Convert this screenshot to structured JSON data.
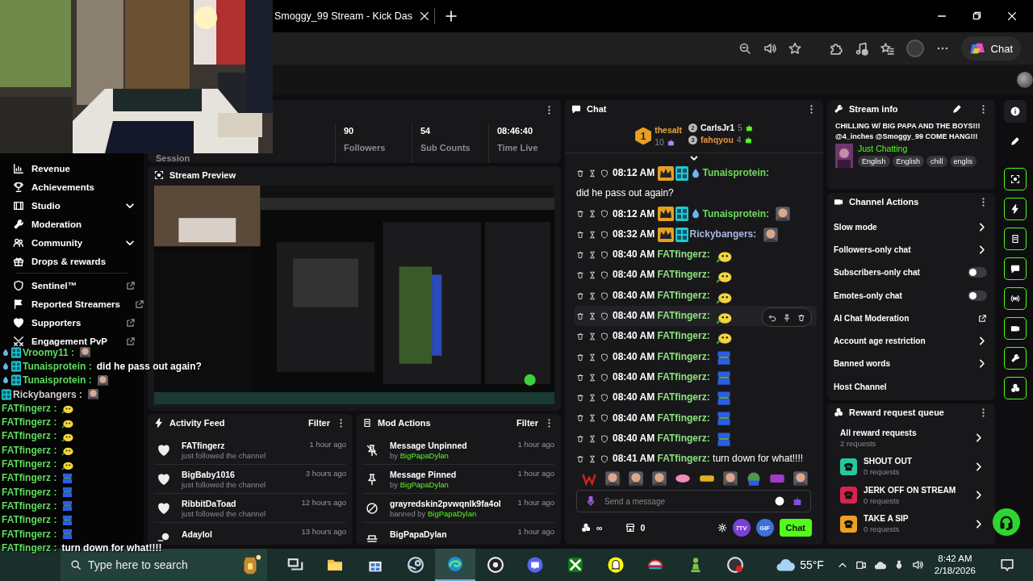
{
  "browser": {
    "tab_title": "Smoggy_99 Stream - Kick Das",
    "copilot_label": "Chat"
  },
  "sidebar": {
    "items": [
      {
        "label": "Revenue",
        "kind": "plain"
      },
      {
        "label": "Achievements",
        "kind": "plain"
      },
      {
        "label": "Studio",
        "kind": "expand"
      },
      {
        "label": "Moderation",
        "kind": "plain"
      },
      {
        "label": "Community",
        "kind": "expand"
      },
      {
        "label": "Drops & rewards",
        "kind": "plain"
      },
      {
        "label": "Sentinel™",
        "kind": "external"
      },
      {
        "label": "Reported Streamers",
        "kind": "external"
      },
      {
        "label": "Supporters",
        "kind": "external"
      },
      {
        "label": "Engagement PvP",
        "kind": "external"
      }
    ]
  },
  "stats": [
    {
      "label": "Session"
    },
    {
      "value": "90",
      "label": "Followers"
    },
    {
      "value": "54",
      "label": "Sub Counts"
    },
    {
      "value": "08:46:40",
      "label": "Time Live"
    }
  ],
  "stream_preview": {
    "title": "Stream Preview"
  },
  "activity_feed": {
    "title": "Activity Feed",
    "filter": "Filter",
    "items": [
      {
        "name": "FATfingerz",
        "detail": "just followed the channel",
        "time": "1 hour ago",
        "kind": "follow"
      },
      {
        "name": "BigBaby1016",
        "detail": "just followed the channel",
        "time": "3 hours ago",
        "kind": "follow"
      },
      {
        "name": "RibbitDaToad",
        "detail": "just followed the channel",
        "time": "12 hours ago",
        "kind": "follow"
      },
      {
        "name": "Adaylol",
        "time": "13 hours ago",
        "kind": "user"
      }
    ]
  },
  "mod_actions": {
    "title": "Mod Actions",
    "filter": "Filter",
    "items": [
      {
        "title": "Message Unpinned",
        "prefix": "by",
        "user": "BigPapaDylan",
        "time": "1 hour ago",
        "kind": "unpin"
      },
      {
        "title": "Message Pinned",
        "prefix": "by",
        "user": "BigPapaDylan",
        "time": "1 hour ago",
        "kind": "pin"
      },
      {
        "title": "grayredskin2pvwqnlk9fa4ol",
        "prefix": "banned by",
        "user": "BigPapaDylan",
        "time": "1 hour ago",
        "kind": "ban"
      },
      {
        "title": "BigPapaDylan",
        "time": "1 hour ago",
        "kind": "hat"
      }
    ]
  },
  "chat": {
    "title": "Chat",
    "leaderboard": [
      {
        "rank": "1",
        "name": "thesalt",
        "count": "10",
        "color": "#e8a53a"
      },
      {
        "rank": "2",
        "name": "CarlsJr1",
        "count": "5",
        "color": "#ffffff"
      },
      {
        "rank": "3",
        "name": "fahqyou",
        "count": "4",
        "color": "#e8933a"
      }
    ],
    "messages": [
      {
        "time": "08:12 AM",
        "badges": [
          {
            "kind": "crown"
          },
          {
            "kind": "grid"
          },
          {
            "kind": "flame"
          }
        ],
        "user": "Tunaisprotein:",
        "color": "#6fdc5a",
        "text": "did he pass out again?",
        "hovered": false
      },
      {
        "time": "08:12 AM",
        "badges": [
          {
            "kind": "crown"
          },
          {
            "kind": "grid"
          },
          {
            "kind": "flame"
          }
        ],
        "user": "Tunaisprotein:",
        "color": "#6fdc5a",
        "emote": {
          "kind": "face"
        },
        "hovered": false
      },
      {
        "time": "08:32 AM",
        "badges": [
          {
            "kind": "crown"
          },
          {
            "kind": "grid"
          }
        ],
        "user": "Rickybangers:",
        "color": "#a9b8e0",
        "emote": {
          "kind": "face"
        },
        "hovered": false
      },
      {
        "time": "08:40 AM",
        "user": "FATfingerz:",
        "color": "#8fe07f",
        "emote": {
          "kind": "smiley"
        },
        "hovered": false
      },
      {
        "time": "08:40 AM",
        "user": "FATfingerz:",
        "color": "#8fe07f",
        "emote": {
          "kind": "smiley"
        },
        "hovered": false
      },
      {
        "time": "08:40 AM",
        "user": "FATfingerz:",
        "color": "#8fe07f",
        "emote": {
          "kind": "smiley"
        },
        "hovered": false
      },
      {
        "time": "08:40 AM",
        "user": "FATfingerz:",
        "color": "#8fe07f",
        "emote": {
          "kind": "smiley"
        },
        "hovered": true
      },
      {
        "time": "08:40 AM",
        "user": "FATfingerz:",
        "color": "#8fe07f",
        "emote": {
          "kind": "smiley"
        },
        "hovered": false
      },
      {
        "time": "08:40 AM",
        "user": "FATfingerz:",
        "color": "#8fe07f",
        "emote": {
          "kind": "blob"
        },
        "hovered": false
      },
      {
        "time": "08:40 AM",
        "user": "FATfingerz:",
        "color": "#8fe07f",
        "emote": {
          "kind": "blob"
        },
        "hovered": false
      },
      {
        "time": "08:40 AM",
        "user": "FATfingerz:",
        "color": "#8fe07f",
        "emote": {
          "kind": "blob"
        },
        "hovered": false
      },
      {
        "time": "08:40 AM",
        "user": "FATfingerz:",
        "color": "#8fe07f",
        "emote": {
          "kind": "blob"
        },
        "hovered": false
      },
      {
        "time": "08:40 AM",
        "user": "FATfingerz:",
        "color": "#8fe07f",
        "emote": {
          "kind": "blob"
        },
        "hovered": false
      },
      {
        "time": "08:41 AM",
        "user": "FATfingerz:",
        "color": "#8fe07f",
        "text": "turn down for what!!!!",
        "hovered": false
      }
    ],
    "emote_bar": [
      {
        "kind": "red"
      },
      {
        "kind": "face"
      },
      {
        "kind": "face"
      },
      {
        "kind": "face"
      },
      {
        "kind": "pink"
      },
      {
        "kind": "gold"
      },
      {
        "kind": "face"
      },
      {
        "kind": "frog"
      },
      {
        "kind": "purple"
      },
      {
        "kind": "face"
      }
    ],
    "input": {
      "placeholder": "Send a message"
    },
    "points": "∞",
    "drops": "0",
    "buttons": [
      {
        "label": "7TV",
        "kind": "seventv"
      },
      {
        "label": "GIF",
        "kind": "gif"
      },
      {
        "label": "Chat",
        "kind": "send"
      }
    ]
  },
  "stream_info": {
    "title": "Stream info",
    "stream_title": "CHILLING W/ BIG PAPA AND THE BOYS!!! @4_inches @Smoggy_99 COME HANG!!!",
    "category": "Just Chatting",
    "tags": [
      "English",
      "English",
      "chill",
      "englis"
    ]
  },
  "channel_actions": {
    "title": "Channel Actions",
    "items": [
      {
        "label": "Slow mode",
        "kind": "link"
      },
      {
        "label": "Followers-only chat",
        "kind": "link"
      },
      {
        "label": "Subscribers-only chat",
        "kind": "toggle",
        "on": false
      },
      {
        "label": "Emotes-only chat",
        "kind": "toggle",
        "on": false
      },
      {
        "label": "AI Chat Moderation",
        "kind": "external"
      },
      {
        "label": "Account age restriction",
        "kind": "link"
      },
      {
        "label": "Banned words",
        "kind": "link"
      },
      {
        "label": "Host Channel",
        "kind": "plain"
      }
    ]
  },
  "reward_queue": {
    "title": "Reward request queue",
    "items": [
      {
        "title": "All reward requests",
        "count": "2 requests",
        "kind": "all"
      },
      {
        "title": "SHOUT OUT",
        "count": "0 requests",
        "kind": "reward",
        "color": "#25c9a0"
      },
      {
        "title": "JERK OFF ON STREAM",
        "count": "0 requests",
        "kind": "reward",
        "color": "#d8224f"
      },
      {
        "title": "TAKE A SIP",
        "count": "0 requests",
        "kind": "reward",
        "color": "#f0a020"
      }
    ]
  },
  "rail": [
    {
      "kind": "plain"
    },
    {
      "kind": "plain"
    },
    {
      "kind": "framed"
    },
    {
      "kind": "framed"
    },
    {
      "kind": "framed"
    },
    {
      "kind": "framed"
    },
    {
      "kind": "framed"
    },
    {
      "kind": "framed"
    },
    {
      "kind": "framed"
    },
    {
      "kind": "framed"
    }
  ],
  "overlay_chat": [
    {
      "badges": [
        {
          "kind": "flame"
        },
        {
          "kind": "grid"
        }
      ],
      "user": "Vroomy11 :",
      "color": "#5fdc5f",
      "emote": {
        "kind": "face"
      }
    },
    {
      "badges": [
        {
          "kind": "flame"
        },
        {
          "kind": "grid"
        }
      ],
      "user": "Tunaisprotein :",
      "color": "#5fdc5f",
      "text": "did he pass out again?"
    },
    {
      "badges": [
        {
          "kind": "flame"
        },
        {
          "kind": "grid"
        }
      ],
      "user": "Tunaisprotein :",
      "color": "#5fdc5f",
      "emote": {
        "kind": "face"
      }
    },
    {
      "badges": [
        {
          "kind": "grid"
        }
      ],
      "user": "Rickybangers :",
      "color": "#cfcfcf",
      "emote": {
        "kind": "face"
      }
    },
    {
      "user": "FATfingerz :",
      "color": "#5fdc5f",
      "emote": {
        "kind": "smiley"
      }
    },
    {
      "user": "FATfingerz :",
      "color": "#5fdc5f",
      "emote": {
        "kind": "smiley"
      }
    },
    {
      "user": "FATfingerz :",
      "color": "#5fdc5f",
      "emote": {
        "kind": "smiley"
      }
    },
    {
      "user": "FATfingerz :",
      "color": "#5fdc5f",
      "emote": {
        "kind": "smiley"
      }
    },
    {
      "user": "FATfingerz :",
      "color": "#5fdc5f",
      "emote": {
        "kind": "smiley"
      }
    },
    {
      "user": "FATfingerz :",
      "color": "#5fdc5f",
      "emote": {
        "kind": "blob"
      }
    },
    {
      "user": "FATfingerz :",
      "color": "#5fdc5f",
      "emote": {
        "kind": "blob"
      }
    },
    {
      "user": "FATfingerz :",
      "color": "#5fdc5f",
      "emote": {
        "kind": "blob"
      }
    },
    {
      "user": "FATfingerz :",
      "color": "#5fdc5f",
      "emote": {
        "kind": "blob"
      }
    },
    {
      "user": "FATfingerz :",
      "color": "#5fdc5f",
      "emote": {
        "kind": "blob"
      }
    },
    {
      "user": "FATfingerz :",
      "color": "#5fdc5f",
      "text": "turn down for what!!!!"
    }
  ],
  "taskbar": {
    "search_placeholder": "Type here to search",
    "apps": [
      {
        "kind": "taskview",
        "selected": false
      },
      {
        "kind": "folder",
        "selected": false
      },
      {
        "kind": "bag",
        "selected": false
      },
      {
        "kind": "disc",
        "selected": false
      },
      {
        "kind": "wave",
        "selected": true
      },
      {
        "kind": "camera",
        "selected": false
      },
      {
        "kind": "chat",
        "selected": false
      },
      {
        "kind": "gamepad",
        "selected": false
      },
      {
        "kind": "ghost",
        "selected": false
      },
      {
        "kind": "cap",
        "selected": false
      },
      {
        "kind": "pawn",
        "selected": false
      },
      {
        "kind": "record",
        "selected": false
      }
    ],
    "weather": "55°F",
    "time": "8:42 AM",
    "date": "2/18/2026"
  }
}
